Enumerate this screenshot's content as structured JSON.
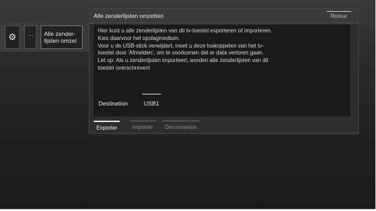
{
  "leftbar": {
    "gear_icon": "gear-icon",
    "more_label": "···",
    "active_item": {
      "line1": "Alle zender-",
      "line2": "lijsten omzet"
    }
  },
  "dialog": {
    "title": "Alle zenderlijsten omzetten",
    "retour_label": "Retour",
    "body_lines": [
      "Hier kunt u alle zenderlijsten van dit tv-toestel exporteren of importeren.",
      "Kies daarvoor het opslagmedium.",
      "Voor u de USB-stick verwijdert, moet u deze loskoppelen van het tv-",
      "toestel door 'Afmelden', om te voorkomen dat er data verloren gaan.",
      "Let op: Als u zenderlijsten importeert, worden alle zenderlijsten van dit",
      "toestel overschreven!"
    ],
    "destination_label": "Destination",
    "destination_value": "USB1",
    "tabs": [
      {
        "label": "Exporter",
        "active": true
      },
      {
        "label": "Importer",
        "active": false
      },
      {
        "label": "Déconnexion",
        "active": false
      }
    ]
  },
  "colors": {
    "background": "#191919",
    "dialog": "#2e2e2e",
    "body": "#1a1a1a",
    "text": "#d8d8d8",
    "inactive_tab": "#8c8c8c"
  }
}
